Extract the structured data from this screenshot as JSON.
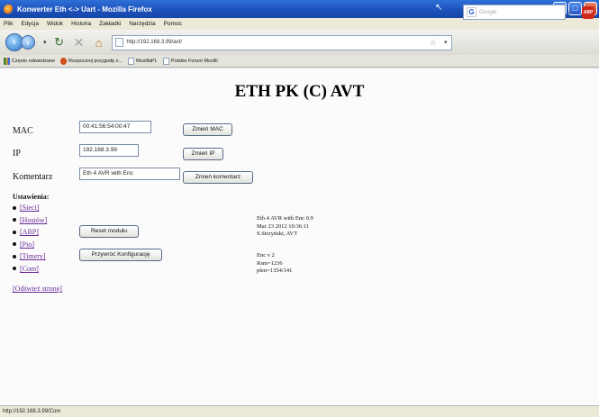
{
  "window": {
    "title": "Konwerter Eth <-> Uart - Mozilla Firefox",
    "min": "_",
    "max": "□",
    "close": "×"
  },
  "menu": [
    "Plik",
    "Edycja",
    "Widok",
    "Historia",
    "Zakładki",
    "Narzędzia",
    "Pomoc"
  ],
  "nav": {
    "url": "http://192.168.3.99/avt/",
    "search_placeholder": "Google",
    "abp": "ABP"
  },
  "bookmarks": [
    "Często odwiedzane",
    "Rozpocznij przygodę z...",
    "MozillaPL",
    "Polskie Forum Mozilli"
  ],
  "page": {
    "title": "ETH PK (C) AVT",
    "mac_label": "MAC",
    "mac_value": "00:41:56:54:00:47",
    "mac_button": "Zmień MAC",
    "ip_label": "IP",
    "ip_value": "192.168.3.99",
    "ip_button": "Zmień IP",
    "comment_label": "Komentarz",
    "comment_value": "Eth 4 AVR with Enc",
    "comment_button": "Zmień komentarz",
    "settings_title": "Ustawienia:",
    "settings_items": [
      "[Sieci]",
      "[Hostów]",
      "[ARP]",
      "[Pio]",
      "[Timery]",
      "[Com]"
    ],
    "reset_button": "Reset modułu",
    "restore_button": "Przywróć Konfigurację",
    "refresh_link": "[Odśwież stronę]",
    "info_lines": [
      "Eth 4 AVR with Enc 0.9",
      "Mar 23 2012 10:36:11",
      "S.Strzyński, AVT"
    ],
    "info_lines2": [
      "Enc v 2",
      "Rsm=1236",
      "plen=1354/141"
    ]
  },
  "status": "http://192.168.3.99/Com"
}
